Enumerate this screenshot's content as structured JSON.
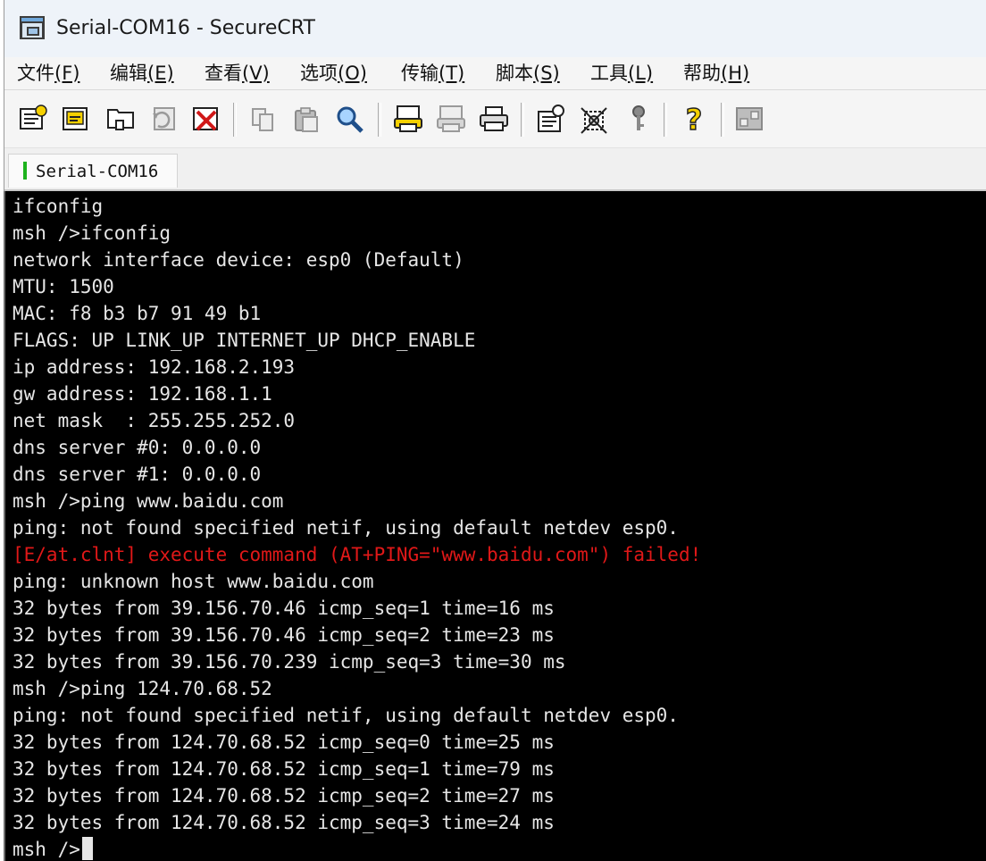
{
  "window": {
    "title": "Serial-COM16 - SecureCRT"
  },
  "menu": {
    "items": [
      {
        "label": "文件",
        "key": "(F)"
      },
      {
        "label": "编辑",
        "key": "(E)"
      },
      {
        "label": "查看",
        "key": "(V)"
      },
      {
        "label": "选项",
        "key": "(O)"
      },
      {
        "label": "传输",
        "key": "(T)"
      },
      {
        "label": "脚本",
        "key": "(S)"
      },
      {
        "label": "工具",
        "key": "(L)"
      },
      {
        "label": "帮助",
        "key": "(H)"
      }
    ]
  },
  "toolbar": {
    "icons": [
      "connect-icon",
      "quick-connect-icon",
      "connect-tab-icon",
      "reconnect-icon",
      "disconnect-icon",
      "copy-icon",
      "paste-icon",
      "find-icon",
      "print-screen-icon",
      "print-selection-icon",
      "print-icon",
      "session-options-icon",
      "global-options-icon",
      "keymap-icon",
      "help-icon",
      "sftp-icon"
    ]
  },
  "tabs": [
    {
      "label": "Serial-COM16",
      "status": "connected",
      "status_color": "#1db31d"
    }
  ],
  "terminal": {
    "background": "#000000",
    "foreground": "#e6e6e6",
    "error_color": "#e01818",
    "lines": [
      {
        "text": "ifconfig",
        "type": "normal"
      },
      {
        "text": "msh />ifconfig",
        "type": "normal"
      },
      {
        "text": "network interface device: esp0 (Default)",
        "type": "normal"
      },
      {
        "text": "MTU: 1500",
        "type": "normal"
      },
      {
        "text": "MAC: f8 b3 b7 91 49 b1",
        "type": "normal"
      },
      {
        "text": "FLAGS: UP LINK_UP INTERNET_UP DHCP_ENABLE",
        "type": "normal"
      },
      {
        "text": "ip address: 192.168.2.193",
        "type": "normal"
      },
      {
        "text": "gw address: 192.168.1.1",
        "type": "normal"
      },
      {
        "text": "net mask  : 255.255.252.0",
        "type": "normal"
      },
      {
        "text": "dns server #0: 0.0.0.0",
        "type": "normal"
      },
      {
        "text": "dns server #1: 0.0.0.0",
        "type": "normal"
      },
      {
        "text": "msh />ping www.baidu.com",
        "type": "normal"
      },
      {
        "text": "ping: not found specified netif, using default netdev esp0.",
        "type": "normal"
      },
      {
        "text": "[E/at.clnt] execute command (AT+PING=\"www.baidu.com\") failed!",
        "type": "error"
      },
      {
        "text": "ping: unknown host www.baidu.com",
        "type": "normal"
      },
      {
        "text": "32 bytes from 39.156.70.46 icmp_seq=1 time=16 ms",
        "type": "normal"
      },
      {
        "text": "32 bytes from 39.156.70.46 icmp_seq=2 time=23 ms",
        "type": "normal"
      },
      {
        "text": "32 bytes from 39.156.70.239 icmp_seq=3 time=30 ms",
        "type": "normal"
      },
      {
        "text": "msh />ping 124.70.68.52",
        "type": "normal"
      },
      {
        "text": "ping: not found specified netif, using default netdev esp0.",
        "type": "normal"
      },
      {
        "text": "32 bytes from 124.70.68.52 icmp_seq=0 time=25 ms",
        "type": "normal"
      },
      {
        "text": "32 bytes from 124.70.68.52 icmp_seq=1 time=79 ms",
        "type": "normal"
      },
      {
        "text": "32 bytes from 124.70.68.52 icmp_seq=2 time=27 ms",
        "type": "normal"
      },
      {
        "text": "32 bytes from 124.70.68.52 icmp_seq=3 time=24 ms",
        "type": "normal"
      },
      {
        "text": "msh />",
        "type": "prompt"
      }
    ]
  }
}
